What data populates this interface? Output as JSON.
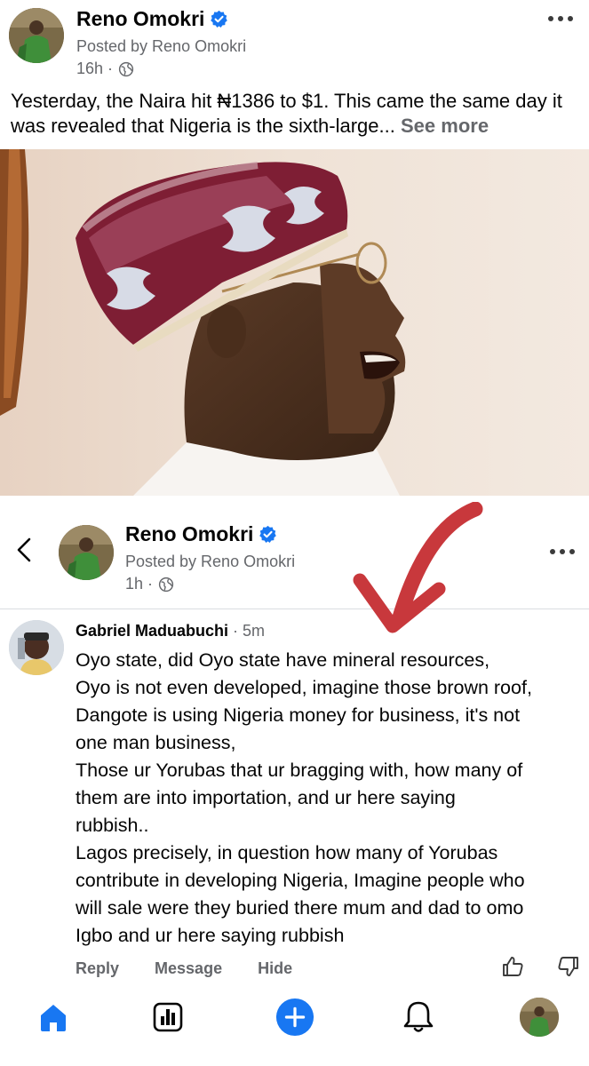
{
  "post": {
    "author": "Reno Omokri",
    "posted_by": "Posted by Reno Omokri",
    "time": "16h",
    "separator": "·",
    "text": "Yesterday, the Naira hit ₦1386 to $1. This came the same day it was revealed that Nigeria is the sixth-large...",
    "see_more": "See more"
  },
  "thread": {
    "author": "Reno Omokri",
    "posted_by": "Posted by Reno Omokri",
    "time": "1h",
    "separator": "·"
  },
  "comment": {
    "name": "Gabriel Maduabuchi",
    "time": "· 5m",
    "lines": [
      "Oyo state, did Oyo state have mineral resources,",
      "Oyo is not even developed, imagine those brown roof,",
      "Dangote is using Nigeria money for business, it's not",
      "one man business,",
      "Those ur Yorubas that ur bragging with, how many of",
      "them are into importation, and ur here saying",
      "rubbish..",
      "Lagos precisely, in question how many of Yorubas",
      "contribute in developing Nigeria,  Imagine people who",
      "will sale were they buried there mum and dad to omo",
      "Igbo and ur here saying rubbish"
    ],
    "actions": {
      "reply": "Reply",
      "message": "Message",
      "hide": "Hide"
    }
  },
  "icons": {
    "verified": "verified-badge-icon",
    "globe": "globe-icon",
    "more": "more-options-icon",
    "back": "back-chevron-icon",
    "like": "thumbs-up-icon",
    "dislike": "thumbs-down-icon",
    "home": "home-icon",
    "insights": "insights-icon",
    "create": "create-plus-icon",
    "notifications": "bell-icon",
    "profile": "profile-avatar"
  },
  "colors": {
    "brand_blue": "#1877f2",
    "secondary_text": "#65676b",
    "annotation_red": "#c8383c"
  }
}
